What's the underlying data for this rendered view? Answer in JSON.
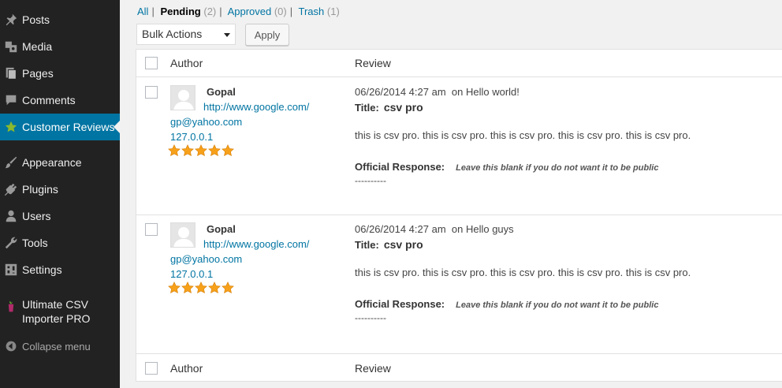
{
  "sidebar": {
    "items": [
      {
        "label": "Posts",
        "icon": "pushpin-icon"
      },
      {
        "label": "Media",
        "icon": "media-icon"
      },
      {
        "label": "Pages",
        "icon": "pages-icon"
      },
      {
        "label": "Comments",
        "icon": "comment-icon"
      },
      {
        "label": "Customer Reviews",
        "icon": "star-icon",
        "active": true
      },
      {
        "label": "Appearance",
        "icon": "paintbrush-icon"
      },
      {
        "label": "Plugins",
        "icon": "plugin-icon"
      },
      {
        "label": "Users",
        "icon": "user-icon"
      },
      {
        "label": "Tools",
        "icon": "wrench-icon"
      },
      {
        "label": "Settings",
        "icon": "settings-icon"
      },
      {
        "label": "Ultimate CSV",
        "label2": "Importer PRO",
        "icon": "csv-icon"
      }
    ],
    "collapse_label": "Collapse menu"
  },
  "filters": {
    "all": "All",
    "pending": "Pending",
    "pending_count": "(2)",
    "approved": "Approved",
    "approved_count": "(0)",
    "trash": "Trash",
    "trash_count": "(1)"
  },
  "bulk": {
    "selected": "Bulk Actions",
    "apply": "Apply"
  },
  "table": {
    "col_author": "Author",
    "col_review": "Review",
    "rows": [
      {
        "author": "Gopal",
        "url": "http://www.google.com/",
        "email": "gp@yahoo.com",
        "ip": "127.0.0.1",
        "rating": 5,
        "date": "06/26/2014 4:27 am",
        "on_text": "on Hello world!",
        "title_label": "Title:",
        "title": "csv pro",
        "body": "this is csv pro. this is csv pro. this is csv pro. this is csv pro. this is csv pro.",
        "response_label": "Official Response:",
        "response_hint": "Leave this blank if you do not want it to be public",
        "dashes": "----------"
      },
      {
        "author": "Gopal",
        "url": "http://www.google.com/",
        "email": "gp@yahoo.com",
        "ip": "127.0.0.1",
        "rating": 5,
        "date": "06/26/2014 4:27 am",
        "on_text": "on Hello guys",
        "title_label": "Title:",
        "title": "csv pro",
        "body": "this is csv pro. this is csv pro. this is csv pro. this is csv pro. this is csv pro.",
        "response_label": "Official Response:",
        "response_hint": "Leave this blank if you do not want it to be public",
        "dashes": "----------"
      }
    ]
  },
  "colors": {
    "sidebar_bg": "#222222",
    "active_bg": "#0074a2",
    "link": "#0074a2",
    "star": "#f7a11a"
  }
}
